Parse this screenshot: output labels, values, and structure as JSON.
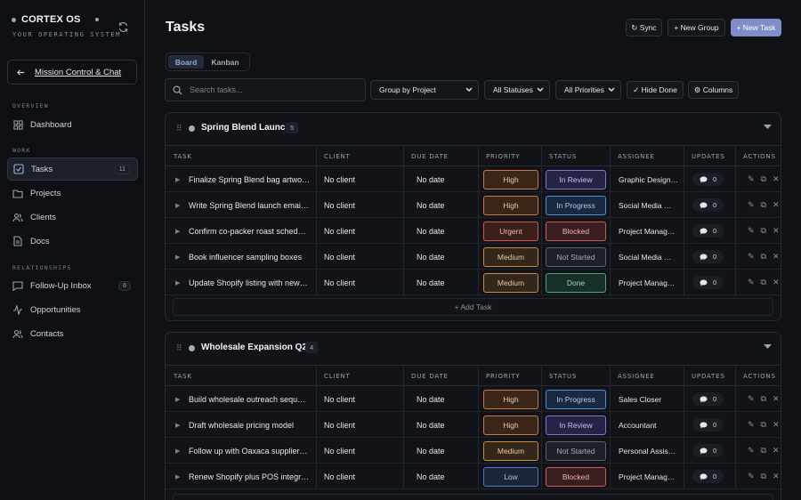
{
  "brand": {
    "name": "CORTEX OS",
    "tagline": "YOUR OPERATING SYSTEM"
  },
  "sidebar": {
    "mission_label": "Mission Control & Chat",
    "sections": [
      {
        "label": "OVERVIEW",
        "items": [
          {
            "label": "Dashboard",
            "icon": "grid-icon"
          }
        ]
      },
      {
        "label": "WORK",
        "items": [
          {
            "label": "Tasks",
            "icon": "checkbox-icon",
            "count": "11",
            "active": true
          },
          {
            "label": "Projects",
            "icon": "folder-icon"
          },
          {
            "label": "Clients",
            "icon": "users-icon"
          },
          {
            "label": "Docs",
            "icon": "document-icon"
          }
        ]
      },
      {
        "label": "RELATIONSHIPS",
        "items": [
          {
            "label": "Follow-Up Inbox",
            "icon": "message-icon",
            "count": "6"
          },
          {
            "label": "Opportunities",
            "icon": "activity-icon"
          },
          {
            "label": "Contacts",
            "icon": "users-icon"
          }
        ]
      }
    ]
  },
  "header": {
    "title": "Tasks",
    "sync_label": "↻ Sync",
    "new_group_label": "+ New Group",
    "new_task_label": "+ New Task"
  },
  "view": {
    "board_label": "Board",
    "kanban_label": "Kanban"
  },
  "filters": {
    "search_placeholder": "Search tasks...",
    "group_by": "Group by Project",
    "statuses": "All Statuses",
    "priorities": "All Priorities",
    "hide_done": "✓ Hide Done",
    "columns": "⚙ Columns"
  },
  "columns": {
    "task": "TASK",
    "client": "CLIENT",
    "due": "DUE DATE",
    "priority": "PRIORITY",
    "status": "STATUS",
    "assignee": "ASSIGNEE",
    "updates": "UPDATES",
    "actions": "ACTIONS"
  },
  "add_task_label": "+ Add Task",
  "colors": {
    "accent": "#7f8ec8",
    "high": "#c97a4a",
    "urgent": "#d9584a",
    "medium": "#c98a3e",
    "low": "#4a78c9",
    "in_review": "#7e76d6",
    "in_progress": "#4f8fd6",
    "blocked": "#d05a5a",
    "not_started": "#7d828b",
    "done": "#4fa37a"
  },
  "groups": [
    {
      "name": "Spring Blend Launch",
      "count": "5",
      "tasks": [
        {
          "title": "Finalize Spring Blend bag artwo…",
          "client": "No client",
          "due": "No date",
          "priority": "High",
          "status": "In Review",
          "assignee": "Graphic Design…",
          "updates": "0"
        },
        {
          "title": "Write Spring Blend launch emai…",
          "client": "No client",
          "due": "No date",
          "priority": "High",
          "status": "In Progress",
          "assignee": "Social Media …",
          "updates": "0"
        },
        {
          "title": "Confirm co-packer roast sched…",
          "client": "No client",
          "due": "No date",
          "priority": "Urgent",
          "status": "Blocked",
          "assignee": "Project Manag…",
          "updates": "0"
        },
        {
          "title": "Book influencer sampling boxes",
          "client": "No client",
          "due": "No date",
          "priority": "Medium",
          "status": "Not Started",
          "assignee": "Social Media …",
          "updates": "0"
        },
        {
          "title": "Update Shopify listing with new…",
          "client": "No client",
          "due": "No date",
          "priority": "Medium",
          "status": "Done",
          "assignee": "Project Manag…",
          "updates": "0"
        }
      ]
    },
    {
      "name": "Wholesale Expansion Q2",
      "count": "4",
      "tasks": [
        {
          "title": "Build wholesale outreach sequ…",
          "client": "No client",
          "due": "No date",
          "priority": "High",
          "status": "In Progress",
          "assignee": "Sales Closer",
          "updates": "0"
        },
        {
          "title": "Draft wholesale pricing model",
          "client": "No client",
          "due": "No date",
          "priority": "High",
          "status": "In Review",
          "assignee": "Accountant",
          "updates": "0"
        },
        {
          "title": "Follow up with Oaxaca supplier…",
          "client": "No client",
          "due": "No date",
          "priority": "Medium",
          "status": "Not Started",
          "assignee": "Personal Assis…",
          "updates": "0"
        },
        {
          "title": "Renew Shopify plus POS integr…",
          "client": "No client",
          "due": "No date",
          "priority": "Low",
          "status": "Blocked",
          "assignee": "Project Manag…",
          "updates": "0"
        }
      ]
    }
  ]
}
